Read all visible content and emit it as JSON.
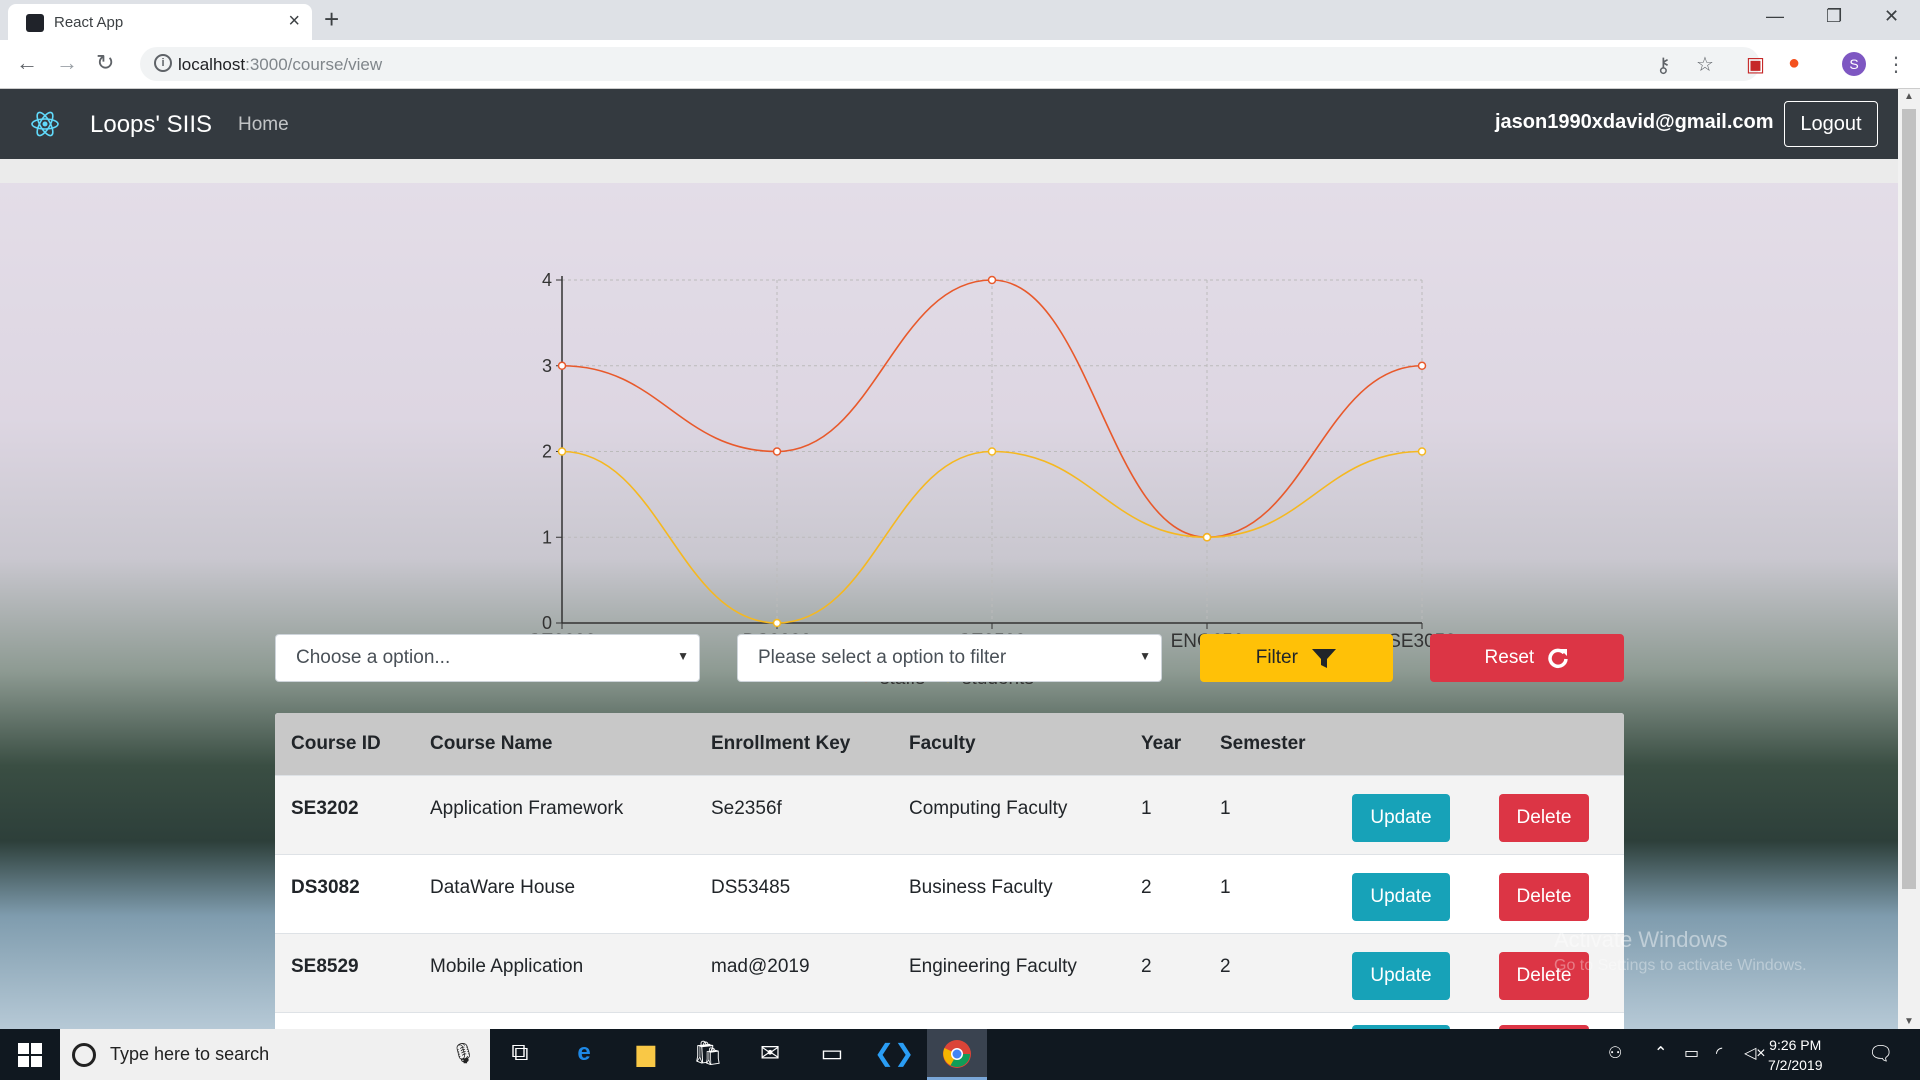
{
  "browser": {
    "tab_title": "React App",
    "url_host": "localhost",
    "url_path": ":3000/course/view",
    "profile_initial": "S"
  },
  "navbar": {
    "brand": "Loops' SIIS",
    "home": "Home",
    "email": "jason1990xdavid@gmail.com",
    "logout": "Logout"
  },
  "chart_data": {
    "type": "line",
    "categories": [
      "SE3202",
      "DS3082",
      "SE8529",
      "ENG656",
      "SE3052"
    ],
    "series": [
      {
        "name": "staffs",
        "values": [
          3,
          2,
          4,
          1,
          3
        ],
        "color": "#e8592b"
      },
      {
        "name": "students",
        "values": [
          2,
          0,
          2,
          1,
          2
        ],
        "color": "#f5b820"
      }
    ],
    "ylim": [
      0,
      4
    ],
    "yticks": [
      0,
      1,
      2,
      3,
      4
    ],
    "grid": true,
    "legend": "bottom"
  },
  "filters": {
    "select1_placeholder": "Choose a option...",
    "select2_placeholder": "Please select a option to filter",
    "filter_label": "Filter",
    "reset_label": "Reset"
  },
  "table": {
    "headers": [
      "Course ID",
      "Course Name",
      "Enrollment Key",
      "Faculty",
      "Year",
      "Semester"
    ],
    "rows": [
      {
        "id": "SE3202",
        "name": "Application Framework",
        "key": "Se2356f",
        "faculty": "Computing Faculty",
        "year": "1",
        "semester": "1"
      },
      {
        "id": "DS3082",
        "name": "DataWare House",
        "key": "DS53485",
        "faculty": "Business Faculty",
        "year": "2",
        "semester": "1"
      },
      {
        "id": "SE8529",
        "name": "Mobile Application",
        "key": "mad@2019",
        "faculty": "Engineering Faculty",
        "year": "2",
        "semester": "2"
      }
    ],
    "update_label": "Update",
    "delete_label": "Delete"
  },
  "watermark": {
    "line1": "Activate Windows",
    "line2": "Go to Settings to activate Windows."
  },
  "taskbar": {
    "search_placeholder": "Type here to search",
    "time": "9:26 PM",
    "date": "7/2/2019"
  }
}
